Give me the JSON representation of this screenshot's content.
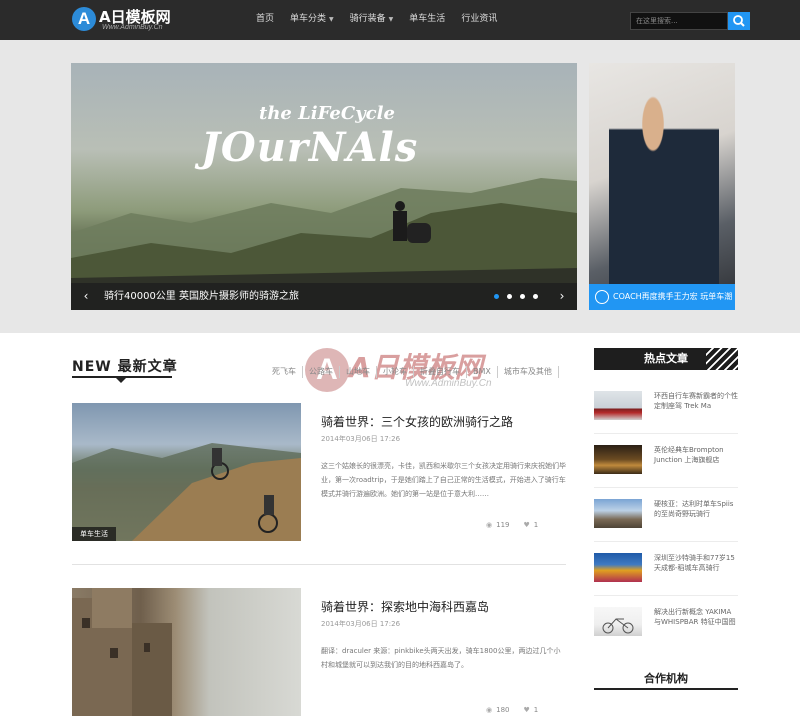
{
  "header": {
    "logo_badge": "A",
    "logo_text": "A日模板网",
    "logo_sub": "Www.AdminBuy.Cn",
    "nav": [
      {
        "label": "首页",
        "dropdown": false
      },
      {
        "label": "单车分类",
        "dropdown": true
      },
      {
        "label": "骑行装备",
        "dropdown": true
      },
      {
        "label": "单车生活",
        "dropdown": false
      },
      {
        "label": "行业资讯",
        "dropdown": false
      }
    ],
    "search_placeholder": "在这里搜索...",
    "search_icon": "search-icon"
  },
  "slider": {
    "art_small": "the LiFeCycle",
    "art_large": "JOurNAls",
    "caption": "骑行40000公里 英国胶片摄影师的骑游之旅",
    "prev": "‹",
    "next": "›",
    "dot_count": 4,
    "active_dot": 1
  },
  "side_ad": {
    "caption": "COACH再度携手王力宏 玩单车潮"
  },
  "watermark": {
    "badge": "A",
    "text": "A日模板网",
    "sub": "Www.AdminBuy.Cn"
  },
  "section": {
    "title": "NEW 最新文章",
    "categories": [
      "死飞车",
      "公路车",
      "山地车",
      "小轮车",
      "折叠自行车",
      "BMX",
      "城市车及其他"
    ]
  },
  "articles": [
    {
      "title": "骑着世界：三个女孩的欧洲骑行之路",
      "date": "2014年03月06日 17:26",
      "excerpt": "这三个姑娘长的很漂亮，卡佳，凯西和米歇尔三个女孩决定用骑行来庆祝她们毕业，第一次roadtrip，于是她们踏上了自己正常的生活模式，开始进入了骑行车模式并骑行游遍欧洲。她们的第一站是位于意大利……",
      "tag": "单车生活",
      "views": "119",
      "likes": "1"
    },
    {
      "title": "骑着世界：探索地中海科西嘉岛",
      "date": "2014年03月06日 17:26",
      "excerpt": "翻译：draculer 来源：pinkbike头两天出发，骑车1800公里，两边过几个小村和城堡就可以到达我们的目的地科西嘉岛了。",
      "tag": "",
      "views": "180",
      "likes": "1"
    }
  ],
  "sidebar": {
    "hot_title": "热点文章",
    "hot_items": [
      "环西自行车赛新霸者的个性定制座驾 Trek Ma",
      "英伦经典车Brompton Junction 上海旗舰店",
      "硬核亚：达利时单车Spiis的至尚奇野玩骑行",
      "深圳至沙特骑手和77岁15天成都-稻城车高骑行",
      "解决出行新概念 YAKIMA与WHISPBAR 特征中国图"
    ],
    "partner_title": "合作机构"
  }
}
